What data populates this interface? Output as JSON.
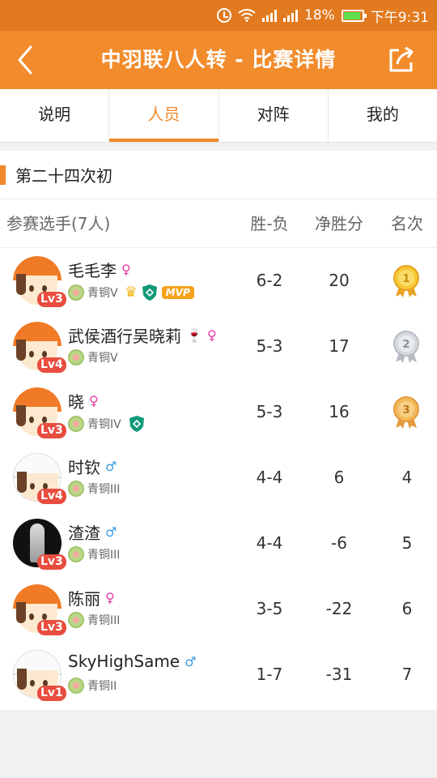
{
  "status_bar": {
    "battery": "18%",
    "time": "下午9:31"
  },
  "header": {
    "title": "中羽联八人转 - 比赛详情"
  },
  "tabs": [
    {
      "label": "说明"
    },
    {
      "label": "人员",
      "active": true
    },
    {
      "label": "对阵"
    },
    {
      "label": "我的"
    }
  ],
  "round_title": "第二十四次初",
  "table": {
    "headers": {
      "player": "参赛选手(7人)",
      "wl": "胜-负",
      "net": "净胜分",
      "rank": "名次"
    },
    "rows": [
      {
        "name": "毛毛李",
        "gender": "♀",
        "lv": "Lv3",
        "level": "青铜V",
        "wl": "6-2",
        "net": "20",
        "rank": "1"
      },
      {
        "name": "武侯酒行吴晓莉",
        "gender": "♀",
        "lv": "Lv4",
        "level": "青铜V",
        "wl": "5-3",
        "net": "17",
        "rank": "2"
      },
      {
        "name": "晓",
        "gender": "♀",
        "lv": "Lv3",
        "level": "青铜IV",
        "wl": "5-3",
        "net": "16",
        "rank": "3"
      },
      {
        "name": "时钦",
        "gender": "♂",
        "lv": "Lv4",
        "level": "青铜III",
        "wl": "4-4",
        "net": "6",
        "rank": "4"
      },
      {
        "name": "渣渣",
        "gender": "♂",
        "lv": "Lv3",
        "level": "青铜III",
        "wl": "4-4",
        "net": "-6",
        "rank": "5"
      },
      {
        "name": "陈丽",
        "gender": "♀",
        "lv": "Lv3",
        "level": "青铜III",
        "wl": "3-5",
        "net": "-22",
        "rank": "6"
      },
      {
        "name": "SkyHighSame",
        "gender": "♂",
        "lv": "Lv1",
        "level": "青铜II",
        "wl": "1-7",
        "net": "-31",
        "rank": "7"
      }
    ]
  },
  "badges": {
    "mvp": "MVP"
  },
  "colors": {
    "accent": "#f0892c",
    "header": "#f28b2c",
    "statusbar": "#e27a1f",
    "female": "#e63ba6",
    "male": "#3a9be3",
    "lv_badge": "#e94d3f"
  }
}
